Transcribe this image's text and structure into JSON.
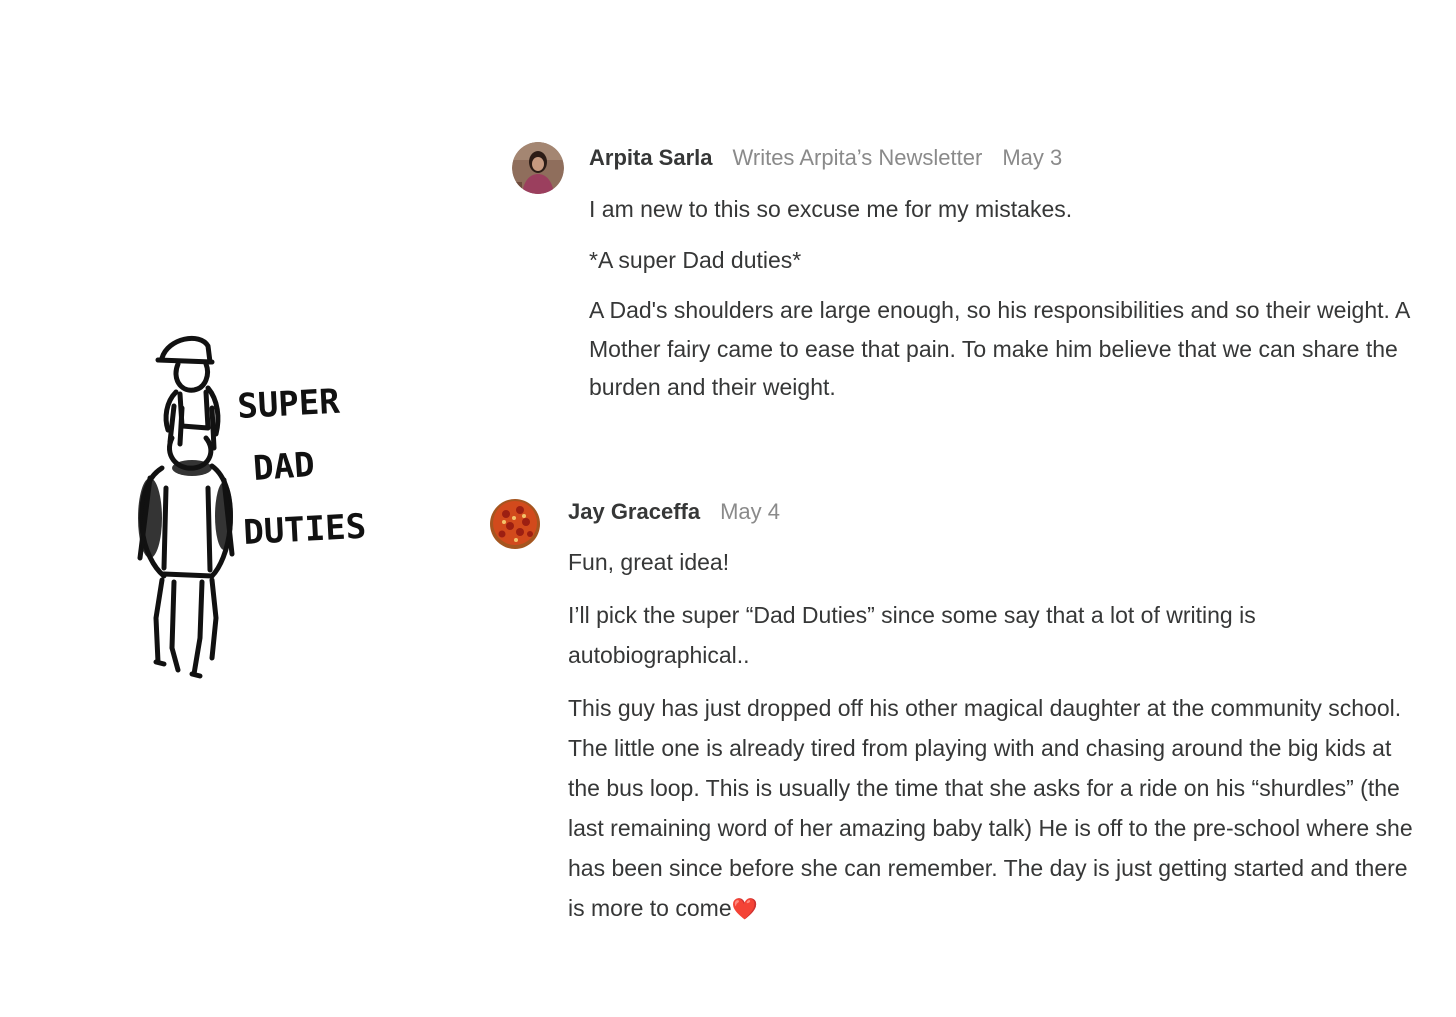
{
  "artwork": {
    "caption_lines": [
      "SUPER",
      "DAD",
      "DUTIES"
    ]
  },
  "comments": [
    {
      "author": "Arpita Sarla",
      "subtitle": "Writes Arpita’s Newsletter",
      "date": "May 3",
      "paragraphs": [
        "I am new to this so excuse me for my mistakes.",
        "*A super Dad duties*",
        "A Dad's shoulders are large enough, so his responsibilities and so their weight. A Mother fairy came to ease that pain. To make him believe that we can share the burden and their weight."
      ]
    },
    {
      "author": "Jay Graceffa",
      "date": "May 4",
      "paragraphs": [
        "Fun, great idea!",
        "I’ll pick the super “Dad Duties” since some say that a lot of writing is autobiographical..",
        "This guy has just dropped off his other magical daughter at the community school. The little one is already tired from playing with and chasing around the big kids at the bus loop. This is usually the time that she asks for a ride on his “shurdles” (the last remaining word of her amazing baby talk) He is off to the pre-school where she has been since before she can remember. The day is just getting started and there is more to come"
      ],
      "trailing_emoji": "❤️"
    }
  ],
  "colors": {
    "text": "#363737",
    "muted": "#8a8a8a",
    "heart": "#e8202a"
  }
}
